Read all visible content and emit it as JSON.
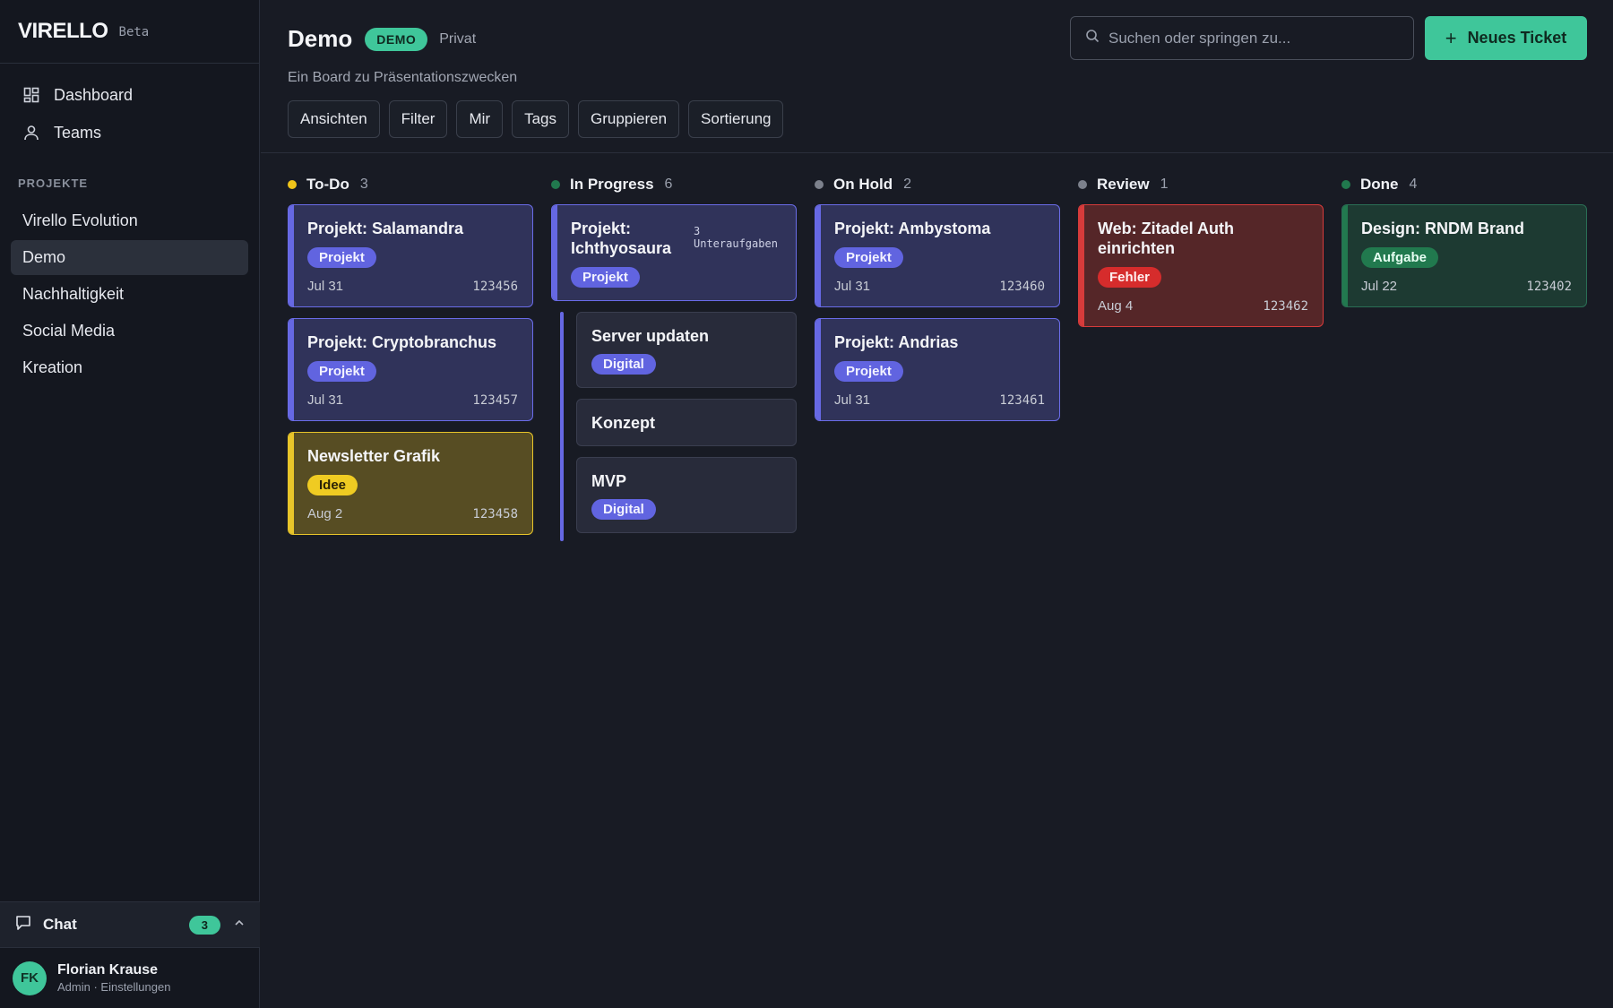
{
  "app": {
    "name": "VIRELLO",
    "badge": "Beta"
  },
  "nav": [
    {
      "label": "Dashboard",
      "icon": "dashboard-icon"
    },
    {
      "label": "Teams",
      "icon": "user-icon"
    }
  ],
  "projects_section": {
    "label": "PROJEKTE",
    "items": [
      "Virello Evolution",
      "Demo",
      "Nachhaltigkeit",
      "Social Media",
      "Kreation"
    ],
    "active": "Demo"
  },
  "chat": {
    "label": "Chat",
    "count": "3"
  },
  "user": {
    "initials": "FK",
    "name": "Florian Krause",
    "role": "Admin · Einstellungen"
  },
  "header": {
    "title": "Demo",
    "badge": "DEMO",
    "privacy": "Privat",
    "subtitle": "Ein Board zu Präsentationszwecken",
    "toolbar": [
      "Ansichten",
      "Filter",
      "Mir",
      "Tags",
      "Gruppieren",
      "Sortierung"
    ],
    "search_placeholder": "Suchen oder springen zu...",
    "new_ticket": "Neues Ticket"
  },
  "colors": {
    "accent": "#3fc69a",
    "todo": "#f0c419",
    "in_progress": "#21794e",
    "on_hold": "#7c818c",
    "review": "#7c818c",
    "done": "#21794e"
  },
  "columns": {
    "todo": {
      "name": "To-Do",
      "count": "3",
      "cards": [
        {
          "title": "Projekt: Salamandra",
          "tag": "Projekt",
          "date": "Jul 31",
          "id": "123456"
        },
        {
          "title": "Projekt: Cryptobranchus",
          "tag": "Projekt",
          "date": "Jul 31",
          "id": "123457"
        },
        {
          "title": "Newsletter Grafik",
          "tag": "Idee",
          "date": "Aug 2",
          "id": "123458"
        }
      ]
    },
    "in_progress": {
      "name": "In Progress",
      "count": "6",
      "parent": {
        "title": "Projekt: Ichthyosaura",
        "tag": "Projekt",
        "subtasks": "3 Unteraufgaben"
      },
      "subtasks": [
        {
          "title": "Server updaten",
          "tag": "Digital"
        },
        {
          "title": "Konzept"
        },
        {
          "title": "MVP",
          "tag": "Digital"
        }
      ]
    },
    "on_hold": {
      "name": "On Hold",
      "count": "2",
      "cards": [
        {
          "title": "Projekt: Ambystoma",
          "tag": "Projekt",
          "date": "Jul 31",
          "id": "123460"
        },
        {
          "title": "Projekt: Andrias",
          "tag": "Projekt",
          "date": "Jul 31",
          "id": "123461"
        }
      ]
    },
    "review": {
      "name": "Review",
      "count": "1",
      "cards": [
        {
          "title": "Web: Zitadel Auth einrichten",
          "tag": "Fehler",
          "date": "Aug 4",
          "id": "123462"
        }
      ]
    },
    "done": {
      "name": "Done",
      "count": "4",
      "cards": [
        {
          "title": "Design: RNDM Brand",
          "tag": "Aufgabe",
          "date": "Jul 22",
          "id": "123402"
        }
      ]
    }
  }
}
